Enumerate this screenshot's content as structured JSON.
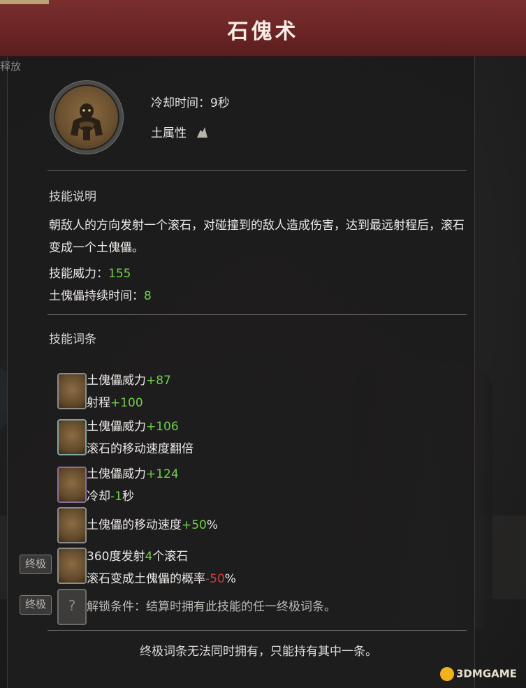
{
  "title": "石傀术",
  "background": {
    "corner_text": "释放"
  },
  "header": {
    "icon": "golem-icon",
    "cooldown": "冷却时间：9秒",
    "element": "土属性",
    "element_icon": "earth-element-icon"
  },
  "description": {
    "heading": "技能说明",
    "text": "朝敌人的方向发射一个滚石，对碰撞到的敌人造成伤害，达到最远射程后，滚石变成一个土傀儡。",
    "power_label": "技能威力：",
    "power_value": "155",
    "duration_label": "土傀儡持续时间：",
    "duration_value": "8"
  },
  "traits": {
    "heading": "技能词条",
    "items": [
      {
        "line1_label": "土傀儡威力",
        "line1_value": "+87",
        "line2_label": "射程",
        "line2_value": "+100",
        "frame": "gray"
      },
      {
        "line1_label": "土傀儡威力",
        "line1_value": "+106",
        "line2_label": "滚石的移动速度翻倍",
        "line2_value": "",
        "frame": "teal"
      },
      {
        "line1_label": "土傀儡威力",
        "line1_value": "+124",
        "line2_label": "冷却",
        "line2_value": "-1",
        "line2_suffix": "秒",
        "frame": "purple"
      },
      {
        "line1_label": "土傀儡的移动速度",
        "line1_value": "+50",
        "line1_suffix": "%",
        "frame": "gray"
      },
      {
        "badge": "终极",
        "line1_pre": "360度发射",
        "line1_value": "4",
        "line1_post": "个滚石",
        "line2_label": "滚石变成土傀儡的概率",
        "line2_value": "-50",
        "line2_suffix": "%",
        "frame": "gray"
      },
      {
        "badge": "终极",
        "icon_text": "?",
        "line1_label": "解锁条件：结算时拥有此技能的任一终极词条。",
        "frame": "locked"
      }
    ]
  },
  "footer": "终极词条无法同时拥有，只能持有其中一条。",
  "watermark": "3DMGAME",
  "colors": {
    "title_bar": "#6a2424",
    "positive": "#6dd04b",
    "negative": "#d33a3a",
    "panel": "#1e1d1d"
  }
}
